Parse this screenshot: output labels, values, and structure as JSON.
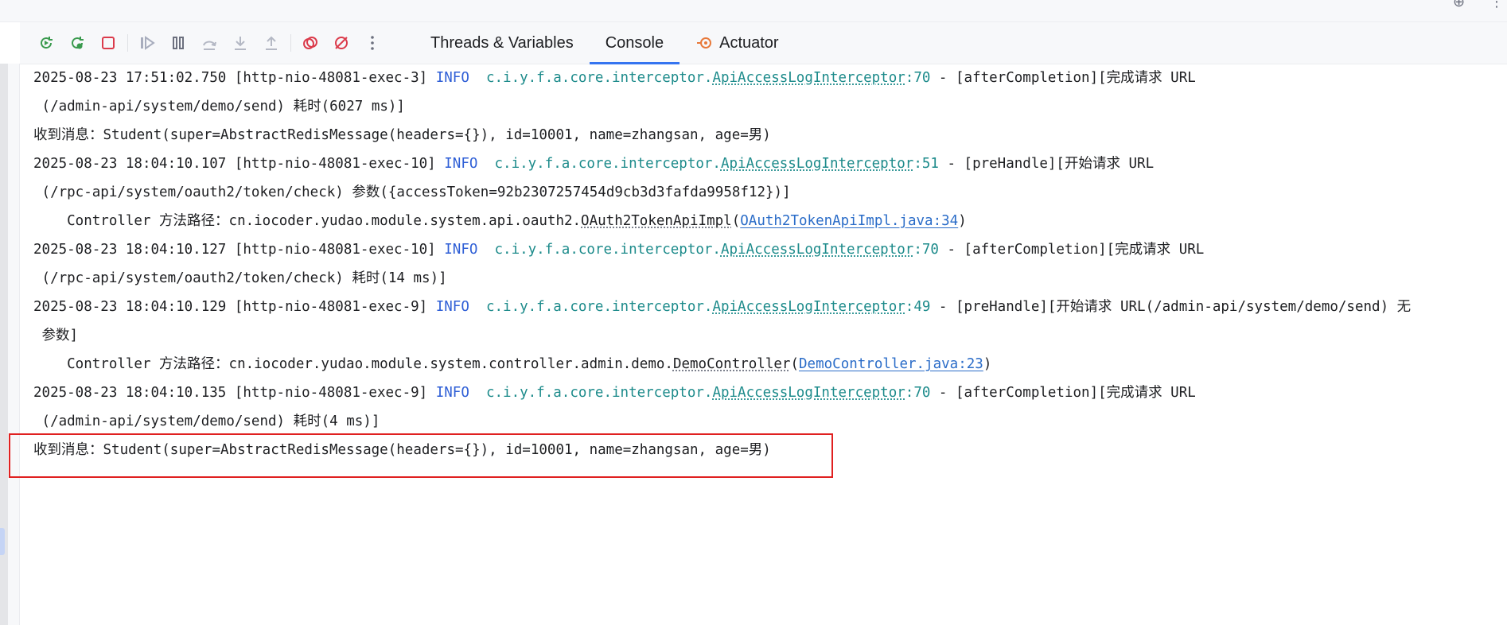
{
  "toolbar": {
    "buttons": [
      {
        "name": "rerun-icon",
        "tooltip": "Rerun"
      },
      {
        "name": "rerun-debug-icon",
        "tooltip": "Rerun Debug"
      },
      {
        "name": "stop-icon",
        "tooltip": "Stop"
      },
      {
        "name": "resume-icon",
        "tooltip": "Resume Program"
      },
      {
        "name": "pause-icon",
        "tooltip": "Pause Program"
      },
      {
        "name": "step-over-icon",
        "tooltip": "Step Over"
      },
      {
        "name": "step-into-icon",
        "tooltip": "Step Into"
      },
      {
        "name": "step-out-icon",
        "tooltip": "Step Out"
      },
      {
        "name": "view-breakpoints-icon",
        "tooltip": "View Breakpoints"
      },
      {
        "name": "mute-breakpoints-icon",
        "tooltip": "Mute Breakpoints"
      },
      {
        "name": "more-options-icon",
        "tooltip": "More"
      }
    ]
  },
  "tabs": [
    {
      "label": "Threads & Variables",
      "active": false
    },
    {
      "label": "Console",
      "active": true
    },
    {
      "label": "Actuator",
      "active": false,
      "icon": "actuator-icon"
    }
  ],
  "colors": {
    "info_level": "#2f5fd6",
    "logger": "#1d8b8b",
    "link": "#2a6cc8",
    "highlight_border": "#e02020",
    "active_tab_underline": "#3574f0"
  },
  "console": {
    "lines": [
      {
        "pre": "2025-08-23 17:51:02.750 [http-nio-48081-exec-3] ",
        "level": "INFO",
        "gap": "  ",
        "logger_prefix": "c.i.y.f.a.core.interceptor.",
        "logger_class": "ApiAccessLogInterceptor",
        "logger_line": ":70",
        "msg": " - [afterCompletion][完成请求 URL"
      },
      {
        "text": " (/admin-api/system/demo/send) 耗时(6027 ms)]"
      },
      {
        "text": "收到消息：Student(super=AbstractRedisMessage(headers={}), id=10001, name=zhangsan, age=男)"
      },
      {
        "pre": "2025-08-23 18:04:10.107 [http-nio-48081-exec-10] ",
        "level": "INFO",
        "gap": "  ",
        "logger_prefix": "c.i.y.f.a.core.interceptor.",
        "logger_class": "ApiAccessLogInterceptor",
        "logger_line": ":51",
        "msg": " - [preHandle][开始请求 URL"
      },
      {
        "text": " (/rpc-api/system/oauth2/token/check) 参数({accessToken=92b2307257454d9cb3d3fafda9958f12})]"
      },
      {
        "pre": "    Controller 方法路径：cn.iocoder.yudao.module.system.api.oauth2.",
        "cls": "OAuth2TokenApiImpl",
        "open": "(",
        "link": "OAuth2TokenApiImpl.java:34",
        "close": ")"
      },
      {
        "pre": "2025-08-23 18:04:10.127 [http-nio-48081-exec-10] ",
        "level": "INFO",
        "gap": "  ",
        "logger_prefix": "c.i.y.f.a.core.interceptor.",
        "logger_class": "ApiAccessLogInterceptor",
        "logger_line": ":70",
        "msg": " - [afterCompletion][完成请求 URL"
      },
      {
        "text": " (/rpc-api/system/oauth2/token/check) 耗时(14 ms)]"
      },
      {
        "pre": "2025-08-23 18:04:10.129 [http-nio-48081-exec-9] ",
        "level": "INFO",
        "gap": "  ",
        "logger_prefix": "c.i.y.f.a.core.interceptor.",
        "logger_class": "ApiAccessLogInterceptor",
        "logger_line": ":49",
        "msg": " - [preHandle][开始请求 URL(/admin-api/system/demo/send) 无"
      },
      {
        "text": " 参数]"
      },
      {
        "pre": "    Controller 方法路径：cn.iocoder.yudao.module.system.controller.admin.demo.",
        "cls": "DemoController",
        "open": "(",
        "link": "DemoController.java:23",
        "close": ")"
      },
      {
        "pre": "2025-08-23 18:04:10.135 [http-nio-48081-exec-9] ",
        "level": "INFO",
        "gap": "  ",
        "logger_prefix": "c.i.y.f.a.core.interceptor.",
        "logger_class": "ApiAccessLogInterceptor",
        "logger_line": ":70",
        "msg": " - [afterCompletion][完成请求 URL"
      },
      {
        "text": " (/admin-api/system/demo/send) 耗时(4 ms)]"
      },
      {
        "text": "收到消息：Student(super=AbstractRedisMessage(headers={}), id=10001, name=zhangsan, age=男)"
      }
    ]
  }
}
